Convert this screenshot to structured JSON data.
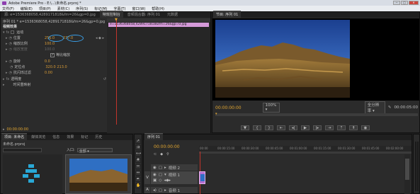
{
  "window": {
    "title": "Adobe Premiere Pro - E:\\...\\未命名.prproj *",
    "controls": [
      "−",
      "□",
      "✕"
    ]
  },
  "menu": [
    "文件(F)",
    "编辑(E)",
    "项目(P)",
    "素材(C)",
    "序列(S)",
    "标记(M)",
    "字幕(T)",
    "窗口(W)",
    "帮助(H)"
  ],
  "source_tabs": [
    "源: e=1536368058,4289171818&fm=26&gp=0.jpg",
    "特效控制台",
    "音频混合器: 序列 01",
    "元数据"
  ],
  "effects": {
    "clip_label": "序列 01 * e=1536368058,4289171818&fm=26&gp=0.jpg",
    "clip_bar": "e=1536368058,4289171818&fm=26&gp=0.jpg",
    "section_video": "视频效果",
    "motion": "运动",
    "position_label": "位置",
    "position_x": "256.0",
    "position_y": "337.0",
    "scale_label": "缩放比例",
    "scale_value": "100.0",
    "scale_width_label": "缩放宽度",
    "scale_width_value": "100.0",
    "uniform_scale": "等比缩放",
    "rotation_label": "旋转",
    "rotation_value": "0.0",
    "anchor_label": "定位点",
    "anchor_x": "320.0",
    "anchor_y": "213.0",
    "flicker_label": "抗闪烁过滤",
    "flicker_value": "0.00",
    "opacity": "透明度",
    "time_remap": "时间重映射",
    "timecode": "00:00:00:00"
  },
  "program": {
    "tab": "节目: 序列 01",
    "timecode_left": "00:00:00:00",
    "zoom": "100%",
    "quality": "全分辨率",
    "timecode_right": "00:00:05:00"
  },
  "project": {
    "tabs": [
      "项目: 未命名",
      "媒体浏览",
      "信息",
      "效果",
      "标记",
      "历史"
    ],
    "file": "未命名.prproj",
    "in_label": "入口:",
    "in_value": "全部"
  },
  "timeline": {
    "tab": "序列 01",
    "timecode": "00:00:00:00",
    "ruler": [
      "00:00",
      "00:00:15:00",
      "00:00:30:00",
      "00:00:45:00",
      "00:01:00:00",
      "00:01:15:00",
      "00:01:30:00",
      "00:01:45:00",
      "00:02:00:00"
    ],
    "tracks": [
      "视频 2",
      "视频 1",
      "音频 1"
    ]
  }
}
